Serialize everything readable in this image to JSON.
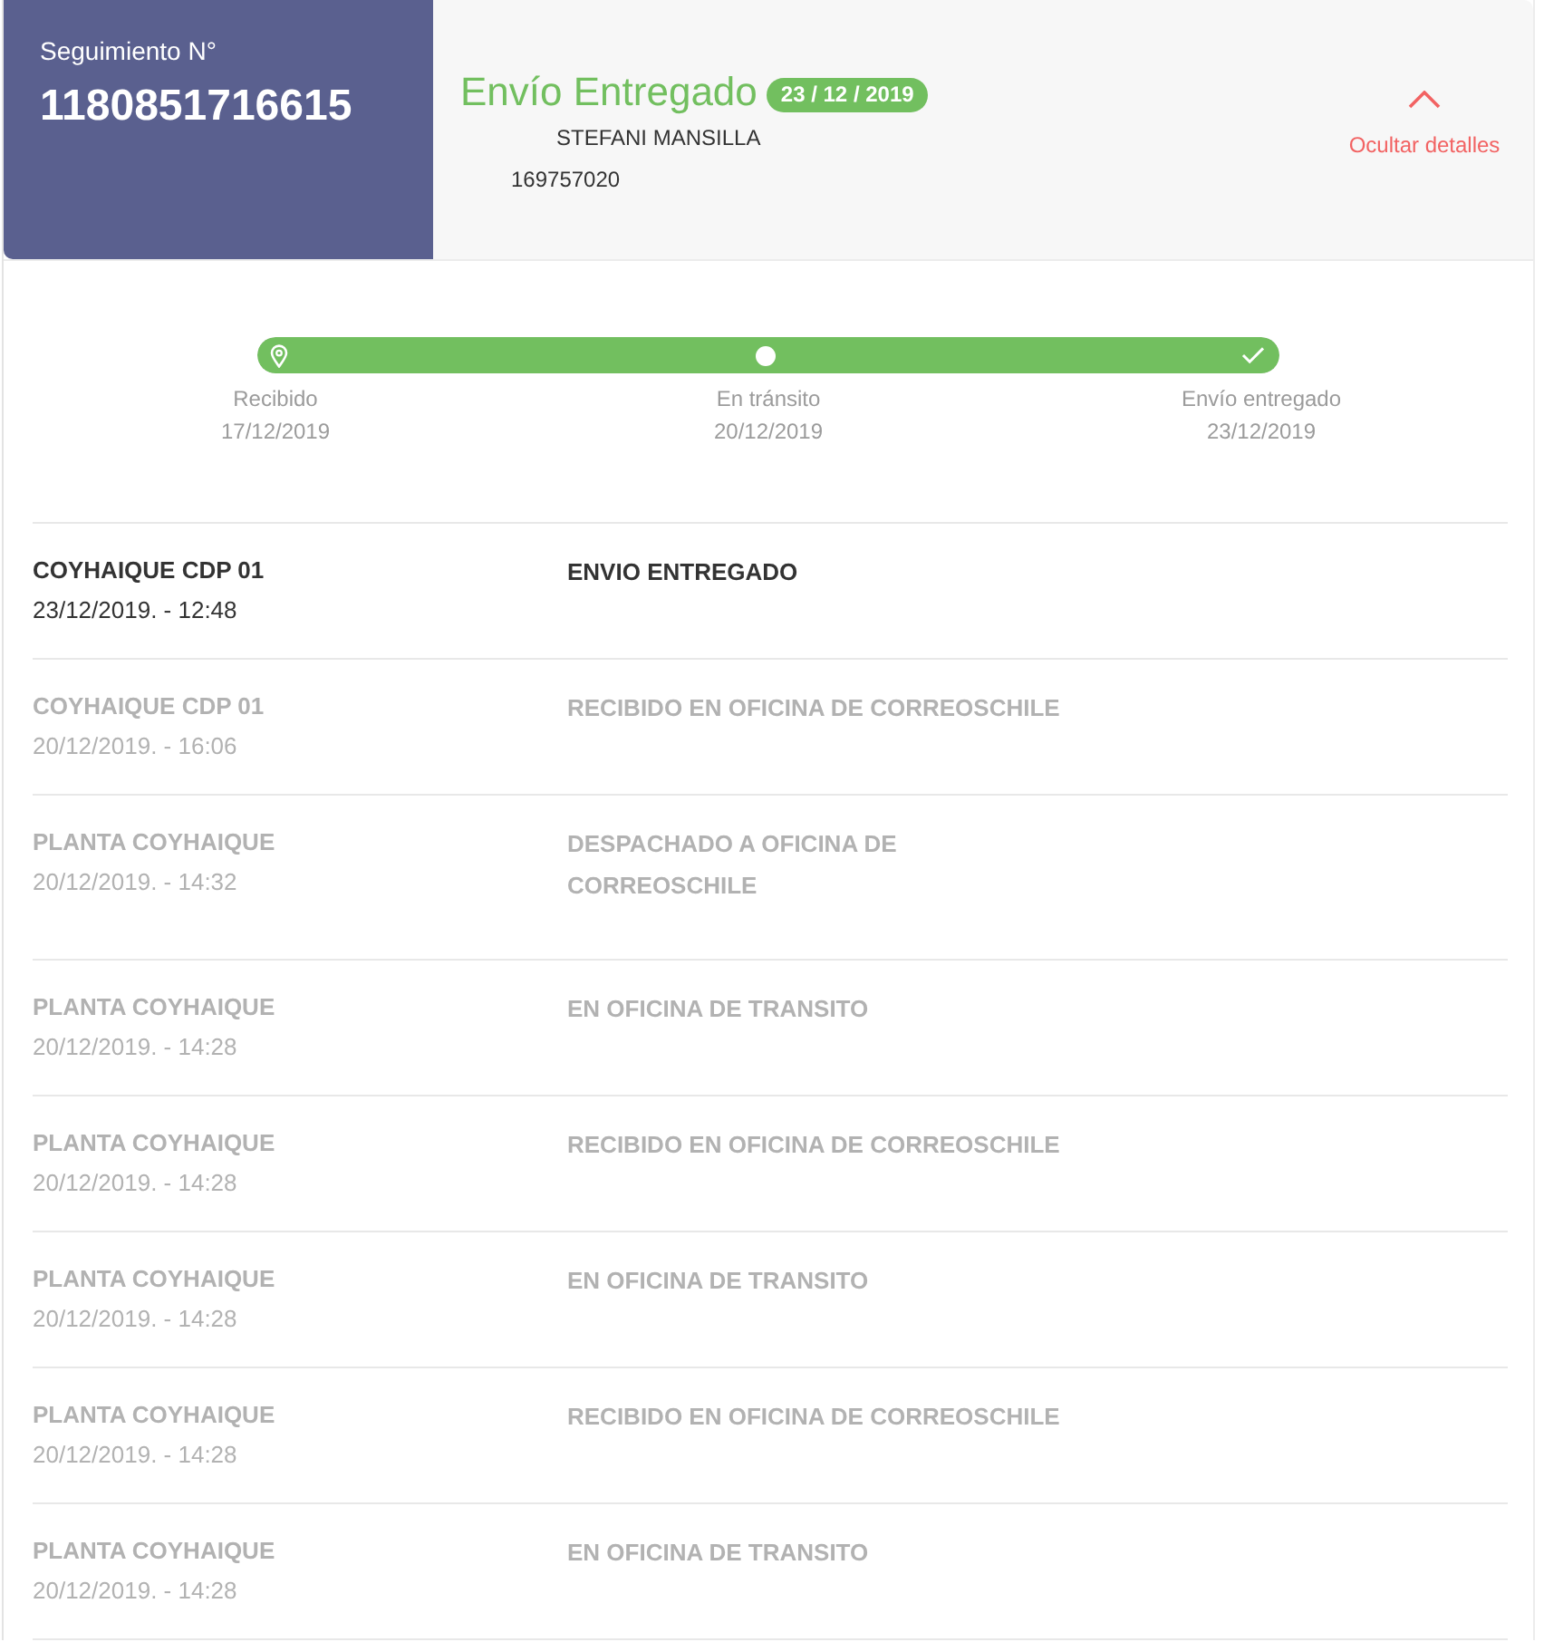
{
  "header": {
    "tracking_label": "Seguimiento N°",
    "tracking_number": "1180851716615",
    "status": "Envío Entregado",
    "status_date": "23 / 12 / 2019",
    "recipient": "STEFANI MANSILLA",
    "recipient_id": "169757020",
    "toggle": {
      "label": "Ocultar detalles",
      "expanded": true
    }
  },
  "progress": {
    "level": 1,
    "steps": [
      {
        "label": "Recibido",
        "date": "17/12/2019"
      },
      {
        "label": "En tránsito",
        "date": "20/12/2019"
      },
      {
        "label": "Envío entregado",
        "date": "23/12/2019"
      }
    ]
  },
  "events": [
    {
      "location": "COYHAIQUE CDP 01",
      "datetime": "23/12/2019. - 12:48",
      "description": "ENVIO ENTREGADO",
      "current": true
    },
    {
      "location": "COYHAIQUE CDP 01",
      "datetime": "20/12/2019. - 16:06",
      "description": "RECIBIDO EN OFICINA DE CORREOSCHILE",
      "current": false
    },
    {
      "location": "PLANTA COYHAIQUE",
      "datetime": "20/12/2019. - 14:32",
      "description": "DESPACHADO A OFICINA DE CORREOSCHILE",
      "current": false
    },
    {
      "location": "PLANTA COYHAIQUE",
      "datetime": "20/12/2019. - 14:28",
      "description": "EN OFICINA DE TRANSITO",
      "current": false
    },
    {
      "location": "PLANTA COYHAIQUE",
      "datetime": "20/12/2019. - 14:28",
      "description": "RECIBIDO EN OFICINA DE CORREOSCHILE",
      "current": false
    },
    {
      "location": "PLANTA COYHAIQUE",
      "datetime": "20/12/2019. - 14:28",
      "description": "EN OFICINA DE TRANSITO",
      "current": false
    },
    {
      "location": "PLANTA COYHAIQUE",
      "datetime": "20/12/2019. - 14:28",
      "description": "RECIBIDO EN OFICINA DE CORREOSCHILE",
      "current": false
    },
    {
      "location": "PLANTA COYHAIQUE",
      "datetime": "20/12/2019. - 14:28",
      "description": "EN OFICINA DE TRANSITO",
      "current": false
    }
  ]
}
